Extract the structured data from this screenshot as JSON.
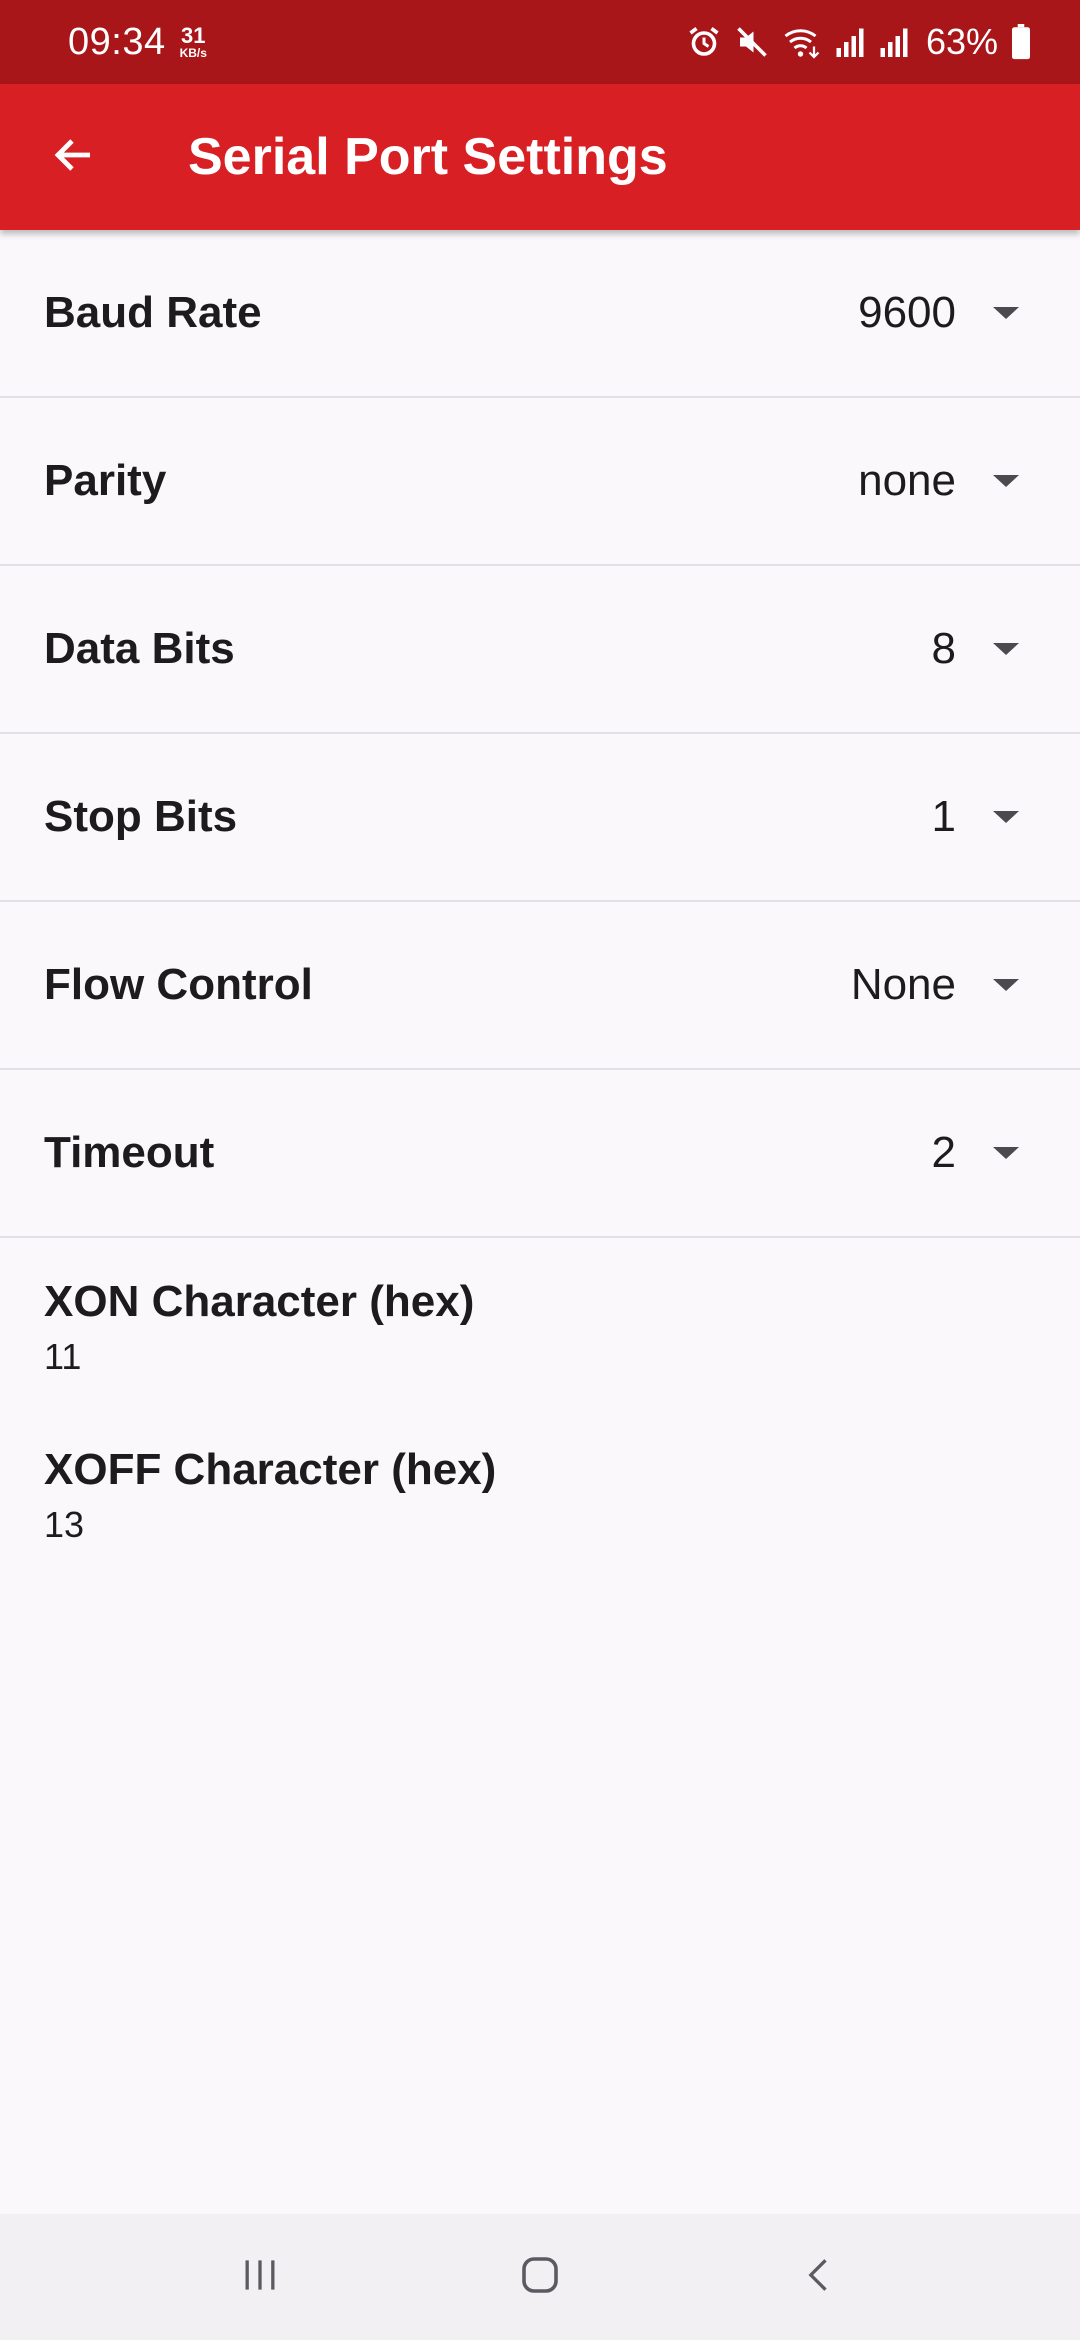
{
  "status_bar": {
    "time": "09:34",
    "speed_value": "31",
    "speed_unit": "KB/s",
    "battery": "63%",
    "icons": [
      "alarm-icon",
      "mute-icon",
      "wifi-icon",
      "signal-icon",
      "signal-icon",
      "battery-icon"
    ]
  },
  "app_bar": {
    "title": "Serial Port Settings",
    "back_icon": "arrow-back-icon",
    "color": "#d81f23"
  },
  "settings": [
    {
      "label": "Baud Rate",
      "value": "9600"
    },
    {
      "label": "Parity",
      "value": "none"
    },
    {
      "label": "Data Bits",
      "value": "8"
    },
    {
      "label": "Stop Bits",
      "value": "1"
    },
    {
      "label": "Flow Control",
      "value": "None"
    },
    {
      "label": "Timeout",
      "value": "2"
    }
  ],
  "text_settings": [
    {
      "label": "XON Character (hex)",
      "value": "11"
    },
    {
      "label": "XOFF Character (hex)",
      "value": "13"
    }
  ],
  "nav_bar": {
    "icons": [
      "recent-apps-icon",
      "home-icon",
      "back-icon"
    ]
  }
}
